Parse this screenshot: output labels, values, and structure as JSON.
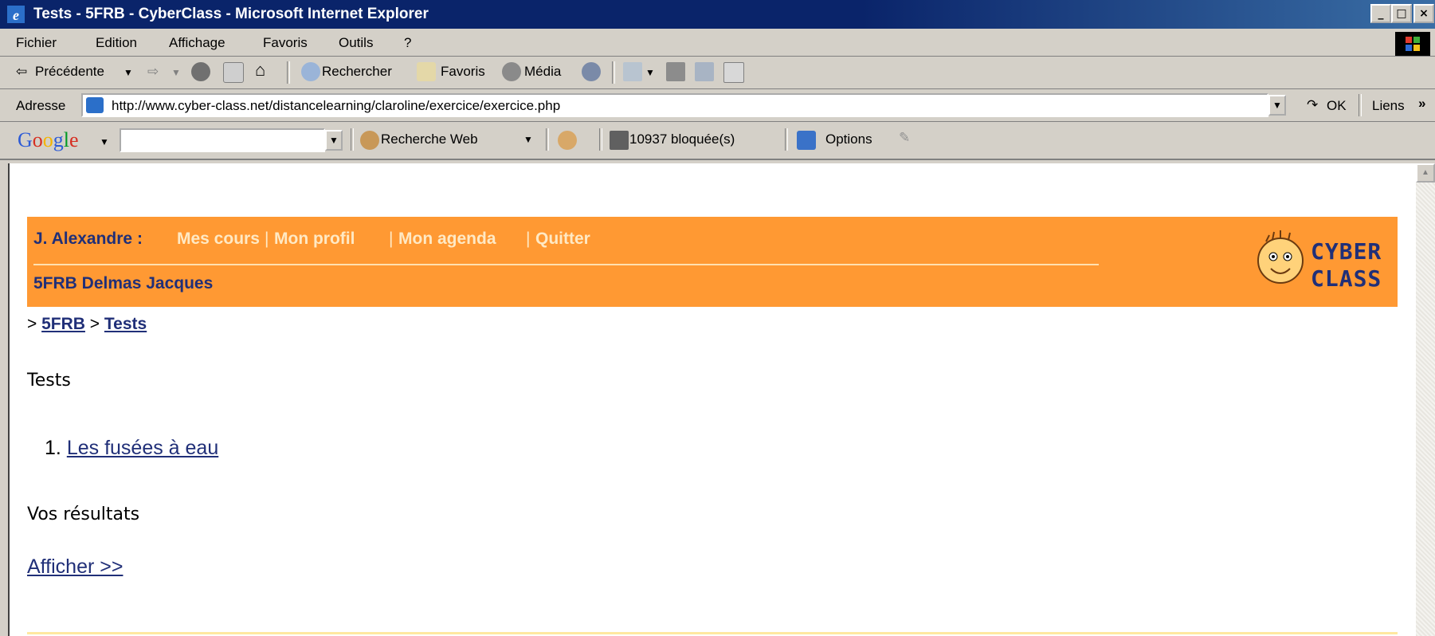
{
  "window": {
    "title": "Tests - 5FRB - CyberClass - Microsoft Internet Explorer",
    "minimize": "_",
    "maximize": "□",
    "close": "×"
  },
  "menubar": {
    "items": [
      "Fichier",
      "Edition",
      "Affichage",
      "Favoris",
      "Outils",
      "?"
    ]
  },
  "toolbar": {
    "back": "Précédente",
    "search": "Rechercher",
    "favorites": "Favoris",
    "media": "Média"
  },
  "address": {
    "label": "Adresse",
    "url": "http://www.cyber-class.net/distancelearning/claroline/exercice/exercice.php",
    "go": "OK",
    "links": "Liens"
  },
  "googlebar": {
    "logo": "Google",
    "search_value": "",
    "search_web": "Recherche Web",
    "blocked": "10937 bloquée(s)",
    "options": "Options"
  },
  "banner": {
    "user": "J. Alexandre :",
    "nav": [
      "Mes cours",
      "Mon profil",
      "Mon agenda",
      "Quitter"
    ],
    "course": "5FRB Delmas Jacques",
    "logo_line1": "CYBER",
    "logo_line2": "CLASS"
  },
  "breadcrumb": {
    "prefix": ">",
    "course": "5FRB",
    "sep": ">",
    "current": "Tests"
  },
  "main": {
    "heading": "Tests",
    "exercises": [
      {
        "number": "1.",
        "title": "Les fusées à eau"
      }
    ],
    "results_heading": "Vos résultats",
    "show_link": "Afficher >>"
  }
}
